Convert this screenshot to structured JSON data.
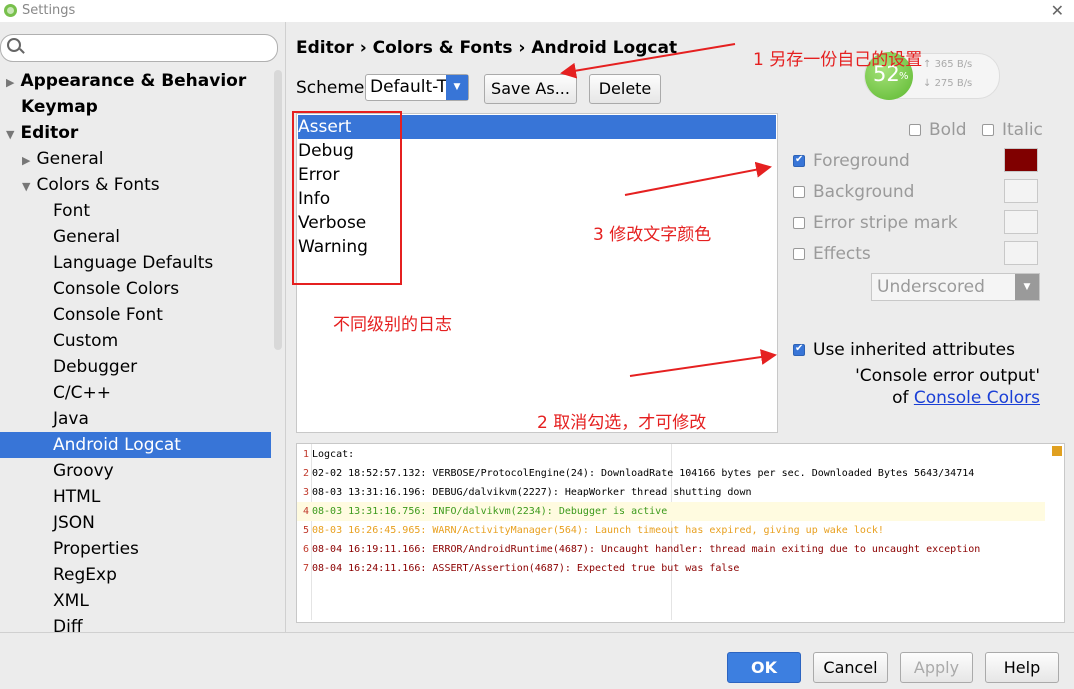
{
  "window": {
    "title": "Settings",
    "close": "✕"
  },
  "sidebar": {
    "search_placeholder": "",
    "items": [
      {
        "label": "Appearance & Behavior",
        "arrow": "▶"
      },
      {
        "label": "Keymap"
      },
      {
        "label": "Editor",
        "arrow": "▼"
      },
      {
        "label": "General",
        "arrow": "▶"
      },
      {
        "label": "Colors & Fonts",
        "arrow": "▼"
      },
      {
        "label": "Font"
      },
      {
        "label": "General"
      },
      {
        "label": "Language Defaults"
      },
      {
        "label": "Console Colors"
      },
      {
        "label": "Console Font"
      },
      {
        "label": "Custom"
      },
      {
        "label": "Debugger"
      },
      {
        "label": "C/C++"
      },
      {
        "label": "Java"
      },
      {
        "label": "Android Logcat"
      },
      {
        "label": "Groovy"
      },
      {
        "label": "HTML"
      },
      {
        "label": "JSON"
      },
      {
        "label": "Properties"
      },
      {
        "label": "RegExp"
      },
      {
        "label": "XML"
      },
      {
        "label": "Diff"
      }
    ]
  },
  "breadcrumb": {
    "p1": "Editor",
    "sep": "›",
    "p2": "Colors & Fonts",
    "p3": "Android Logcat"
  },
  "scheme": {
    "label": "Scheme:",
    "value": "Default-T",
    "save_as": "Save As...",
    "delete": "Delete"
  },
  "levels": [
    "Assert",
    "Debug",
    "Error",
    "Info",
    "Verbose",
    "Warning"
  ],
  "attributes": {
    "bold": "Bold",
    "italic": "Italic",
    "foreground": "Foreground",
    "background": "Background",
    "error_stripe": "Error stripe mark",
    "effects": "Effects",
    "effect_type": "Underscored",
    "use_inherited": "Use inherited attributes",
    "inherited_from": "'Console error output'",
    "of": "of",
    "link": "Console Colors",
    "foreground_color": "#800000"
  },
  "preview": [
    {
      "n": "1",
      "text": "Logcat:",
      "color": "#000000"
    },
    {
      "n": "2",
      "text": "02-02 18:52:57.132: VERBOSE/ProtocolEngine(24): DownloadRate 104166 bytes per sec. Downloaded Bytes 5643/34714",
      "color": "#000000"
    },
    {
      "n": "3",
      "text": "08-03 13:31:16.196: DEBUG/dalvikvm(2227): HeapWorker thread shutting down",
      "color": "#000000"
    },
    {
      "n": "4",
      "text": "08-03 13:31:16.756: INFO/dalvikvm(2234): Debugger is active",
      "color": "#3c9a1c"
    },
    {
      "n": "5",
      "text": "08-03 16:26:45.965: WARN/ActivityManager(564): Launch timeout has expired, giving up wake lock!",
      "color": "#e8a020"
    },
    {
      "n": "6",
      "text": "08-04 16:19:11.166: ERROR/AndroidRuntime(4687): Uncaught handler: thread main exiting due to uncaught exception",
      "color": "#8b0000"
    },
    {
      "n": "7",
      "text": "08-04 16:24:11.166: ASSERT/Assertion(4687): Expected true but was false",
      "color": "#8b0000"
    }
  ],
  "net_widget": {
    "percent": "52",
    "pct_sign": "%",
    "up": "365 B/s",
    "down": "275 B/s"
  },
  "annotations": {
    "a1": "1 另存一份自己的设置",
    "a2": "2 取消勾选，才可修改",
    "a3": "3 修改文字颜色",
    "a4": "不同级别的日志"
  },
  "buttons": {
    "ok": "OK",
    "cancel": "Cancel",
    "apply": "Apply",
    "help": "Help"
  }
}
